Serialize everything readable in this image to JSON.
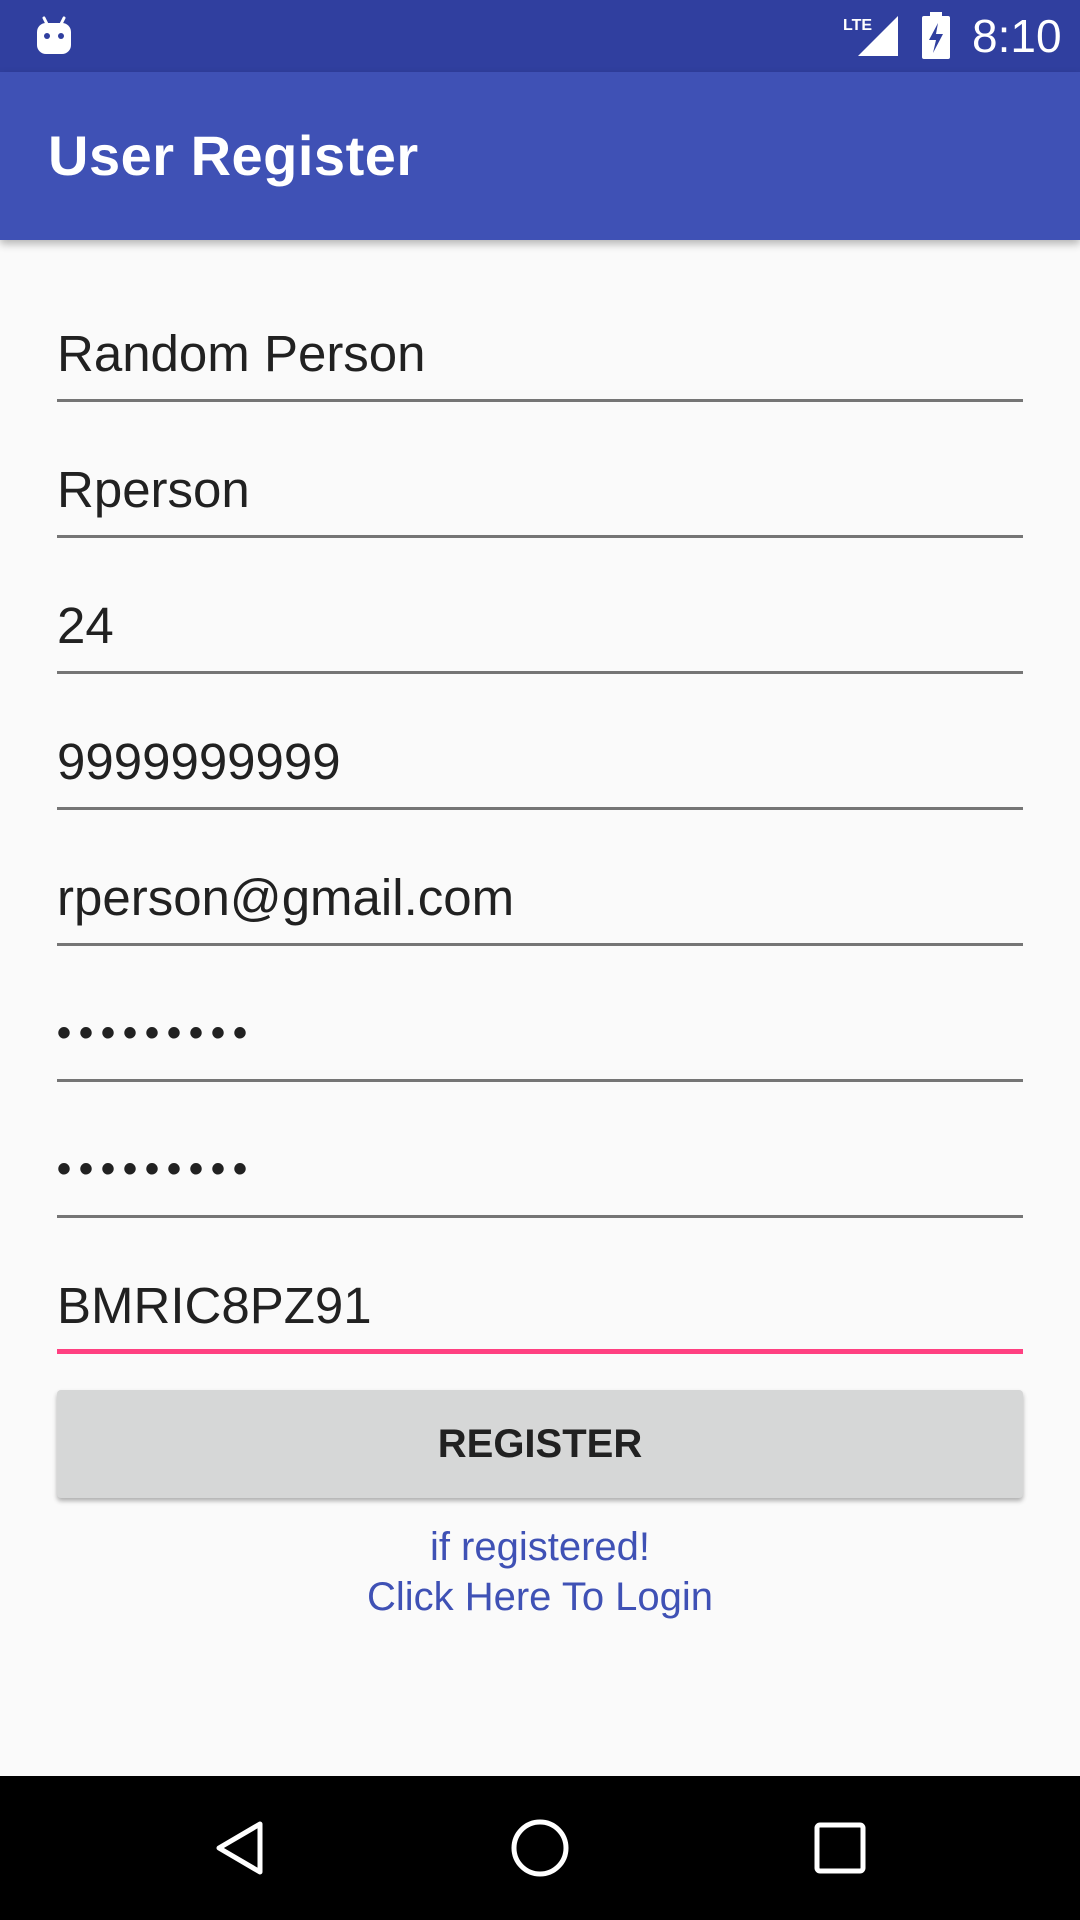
{
  "status_bar": {
    "network_label": "LTE",
    "time": "8:10"
  },
  "app_bar": {
    "title": "User Register"
  },
  "form": {
    "fields": [
      {
        "value": "Random Person",
        "type": "text"
      },
      {
        "value": "Rperson",
        "type": "text"
      },
      {
        "value": "24",
        "type": "text"
      },
      {
        "value": "9999999999",
        "type": "text"
      },
      {
        "value": "rperson@gmail.com",
        "type": "text"
      },
      {
        "value": "•••••••••",
        "type": "password"
      },
      {
        "value": "•••••••••",
        "type": "password"
      },
      {
        "value": "BMRIC8PZ91",
        "type": "text"
      }
    ],
    "register_label": "REGISTER"
  },
  "login_link": {
    "line1": "if registered!",
    "line2": "Click Here To Login"
  },
  "colors": {
    "status_bar": "#303f9f",
    "app_bar": "#3f51b5",
    "accent": "#ff4081",
    "link": "#3f51b5",
    "button": "#d6d7d7",
    "background": "#fafafa"
  },
  "icons": {
    "notification": "android-debug-icon",
    "signal": "lte-signal-icon",
    "battery": "battery-charging-icon",
    "nav_back": "back-triangle-icon",
    "nav_home": "home-circle-icon",
    "nav_recents": "recents-square-icon"
  }
}
